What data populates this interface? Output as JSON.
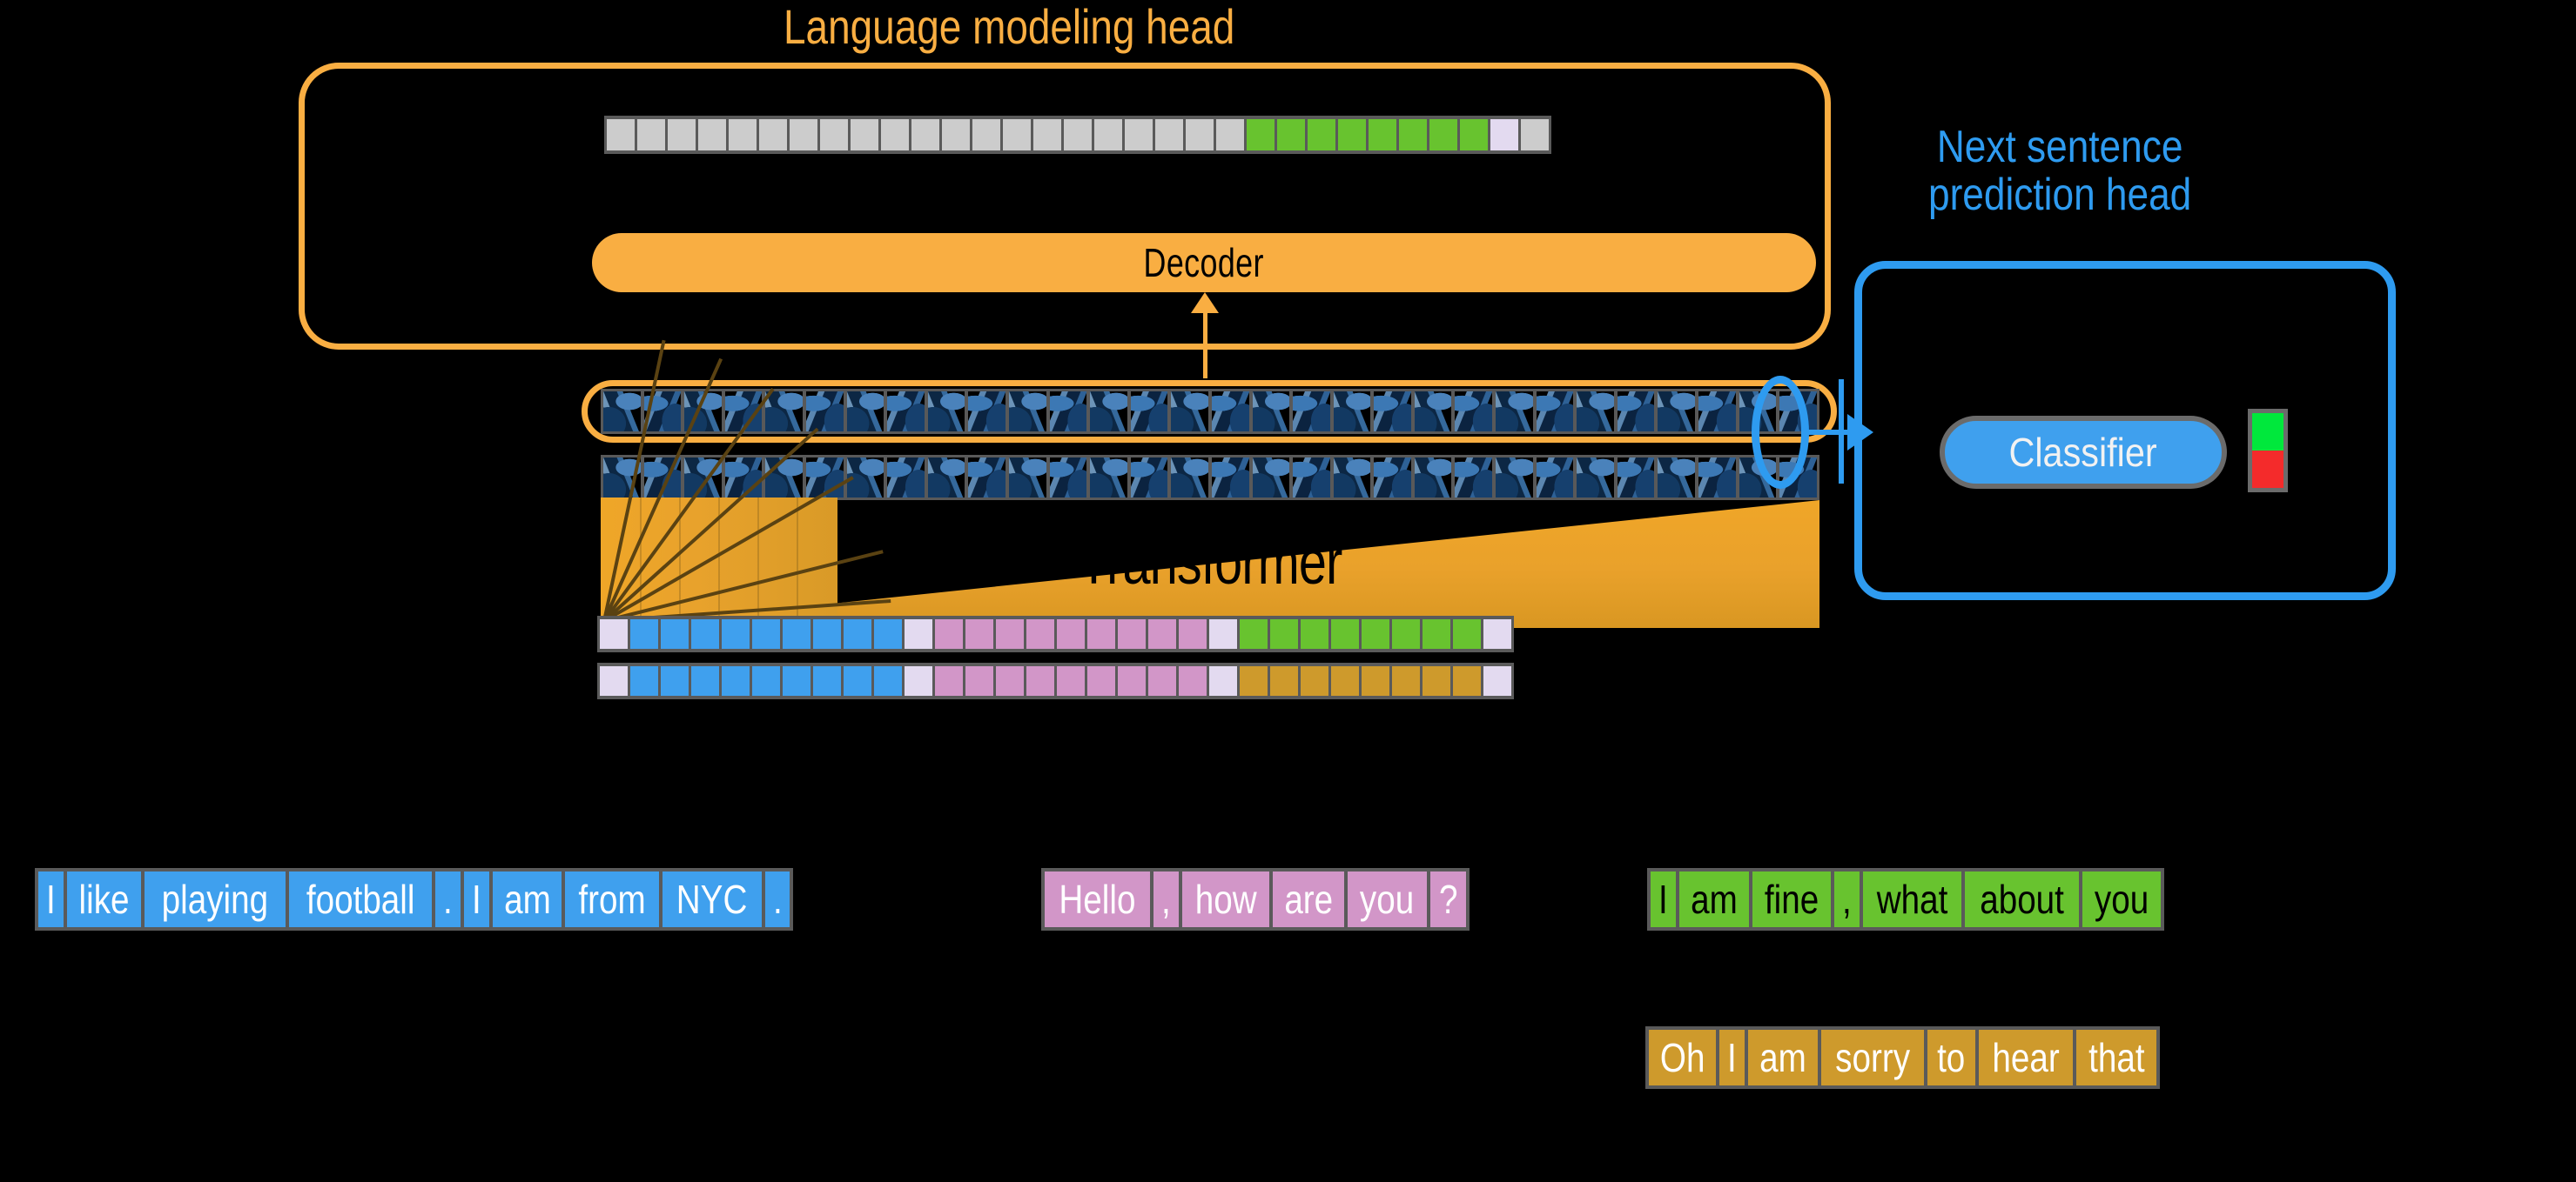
{
  "titles": {
    "lm_head": "Language modeling head",
    "nsp_head_line1": "Next sentence",
    "nsp_head_line2": "prediction head"
  },
  "blocks": {
    "decoder_label": "Decoder",
    "transformer_label": "Transformer",
    "classifier_label": "Classifier"
  },
  "colors": {
    "orange_accent": "#F9AE42",
    "blue_accent": "#2E9BF0",
    "token_blue": "#3FA0EE",
    "token_pink": "#D296C8",
    "token_green": "#68C32F",
    "token_gold": "#CE9A2C",
    "token_separator": "#E3DAF0",
    "token_gray": "#CCCCCC",
    "strip_border": "#5A5A5A",
    "classifier_fill": "#3FA0EE",
    "nsp_positive": "#00E83C",
    "nsp_negative": "#F42B2B"
  },
  "logits_strip": {
    "name": "language-model-output-logits",
    "cells": [
      {
        "color": "#CCCCCC"
      },
      {
        "color": "#CCCCCC"
      },
      {
        "color": "#CCCCCC"
      },
      {
        "color": "#CCCCCC"
      },
      {
        "color": "#CCCCCC"
      },
      {
        "color": "#CCCCCC"
      },
      {
        "color": "#CCCCCC"
      },
      {
        "color": "#CCCCCC"
      },
      {
        "color": "#CCCCCC"
      },
      {
        "color": "#CCCCCC"
      },
      {
        "color": "#CCCCCC"
      },
      {
        "color": "#CCCCCC"
      },
      {
        "color": "#CCCCCC"
      },
      {
        "color": "#CCCCCC"
      },
      {
        "color": "#CCCCCC"
      },
      {
        "color": "#CCCCCC"
      },
      {
        "color": "#CCCCCC"
      },
      {
        "color": "#CCCCCC"
      },
      {
        "color": "#CCCCCC"
      },
      {
        "color": "#CCCCCC"
      },
      {
        "color": "#CCCCCC"
      },
      {
        "color": "#68C32F"
      },
      {
        "color": "#68C32F"
      },
      {
        "color": "#68C32F"
      },
      {
        "color": "#68C32F"
      },
      {
        "color": "#68C32F"
      },
      {
        "color": "#68C32F"
      },
      {
        "color": "#68C32F"
      },
      {
        "color": "#68C32F"
      },
      {
        "color": "#E3DAF0"
      },
      {
        "color": "#CCCCCC"
      }
    ]
  },
  "embedding_strip_1": {
    "name": "input-embeddings-sequence-a",
    "cells": [
      {
        "color": "#E3DAF0"
      },
      {
        "color": "#3FA0EE"
      },
      {
        "color": "#3FA0EE"
      },
      {
        "color": "#3FA0EE"
      },
      {
        "color": "#3FA0EE"
      },
      {
        "color": "#3FA0EE"
      },
      {
        "color": "#3FA0EE"
      },
      {
        "color": "#3FA0EE"
      },
      {
        "color": "#3FA0EE"
      },
      {
        "color": "#3FA0EE"
      },
      {
        "color": "#E3DAF0"
      },
      {
        "color": "#D296C8"
      },
      {
        "color": "#D296C8"
      },
      {
        "color": "#D296C8"
      },
      {
        "color": "#D296C8"
      },
      {
        "color": "#D296C8"
      },
      {
        "color": "#D296C8"
      },
      {
        "color": "#D296C8"
      },
      {
        "color": "#D296C8"
      },
      {
        "color": "#D296C8"
      },
      {
        "color": "#E3DAF0"
      },
      {
        "color": "#68C32F"
      },
      {
        "color": "#68C32F"
      },
      {
        "color": "#68C32F"
      },
      {
        "color": "#68C32F"
      },
      {
        "color": "#68C32F"
      },
      {
        "color": "#68C32F"
      },
      {
        "color": "#68C32F"
      },
      {
        "color": "#68C32F"
      },
      {
        "color": "#E3DAF0"
      }
    ]
  },
  "embedding_strip_2": {
    "name": "input-embeddings-sequence-b",
    "cells": [
      {
        "color": "#E3DAF0"
      },
      {
        "color": "#3FA0EE"
      },
      {
        "color": "#3FA0EE"
      },
      {
        "color": "#3FA0EE"
      },
      {
        "color": "#3FA0EE"
      },
      {
        "color": "#3FA0EE"
      },
      {
        "color": "#3FA0EE"
      },
      {
        "color": "#3FA0EE"
      },
      {
        "color": "#3FA0EE"
      },
      {
        "color": "#3FA0EE"
      },
      {
        "color": "#E3DAF0"
      },
      {
        "color": "#D296C8"
      },
      {
        "color": "#D296C8"
      },
      {
        "color": "#D296C8"
      },
      {
        "color": "#D296C8"
      },
      {
        "color": "#D296C8"
      },
      {
        "color": "#D296C8"
      },
      {
        "color": "#D296C8"
      },
      {
        "color": "#D296C8"
      },
      {
        "color": "#D296C8"
      },
      {
        "color": "#E3DAF0"
      },
      {
        "color": "#CE9A2C"
      },
      {
        "color": "#CE9A2C"
      },
      {
        "color": "#CE9A2C"
      },
      {
        "color": "#CE9A2C"
      },
      {
        "color": "#CE9A2C"
      },
      {
        "color": "#CE9A2C"
      },
      {
        "color": "#CE9A2C"
      },
      {
        "color": "#CE9A2C"
      },
      {
        "color": "#E3DAF0"
      }
    ]
  },
  "hidden_states": {
    "name": "transformer-hidden-states",
    "top_row_cells": 30,
    "bottom_row_cells": 30
  },
  "nsp_outputs": [
    {
      "name": "is-next-indicator",
      "color": "#00E83C"
    },
    {
      "name": "not-next-indicator",
      "color": "#F42B2B"
    }
  ],
  "sentences": [
    {
      "name": "sentence-blue",
      "style": "tok-blue",
      "tokens": [
        "I",
        "like",
        "playing",
        "football",
        ".",
        "I",
        "am",
        "from",
        "NYC",
        "."
      ]
    },
    {
      "name": "sentence-pink",
      "style": "tok-pink",
      "tokens": [
        "Hello",
        ",",
        "how",
        "are",
        "you",
        "?"
      ]
    },
    {
      "name": "sentence-green",
      "style": "tok-green",
      "tokens": [
        "I",
        "am",
        "fine",
        ",",
        "what",
        "about",
        "you"
      ]
    },
    {
      "name": "sentence-gold",
      "style": "tok-gold",
      "tokens": [
        "Oh",
        "I",
        "am",
        "sorry",
        "to",
        "hear",
        "that"
      ]
    }
  ]
}
